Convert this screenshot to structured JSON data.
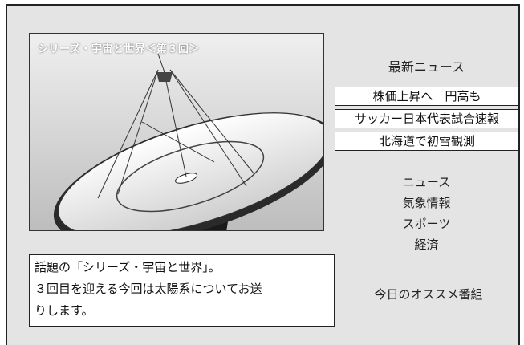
{
  "video": {
    "title": "シリーズ・宇宙と世界＜第３回＞",
    "image": "radio-telescope-dish"
  },
  "news": {
    "heading": "最新ニュース",
    "headlines": [
      "株価上昇へ　円高も",
      "サッカー日本代表試合速報",
      "北海道で初雪観測"
    ]
  },
  "menu": {
    "items": [
      "ニュース",
      "気象情報",
      "スポーツ",
      "経済"
    ]
  },
  "description": {
    "lines": [
      "話題の「シリーズ・宇宙と世界」。",
      "３回目を迎える今回は太陽系についてお送",
      "りします。"
    ]
  },
  "recommend": {
    "label": "今日のオススメ番組"
  }
}
